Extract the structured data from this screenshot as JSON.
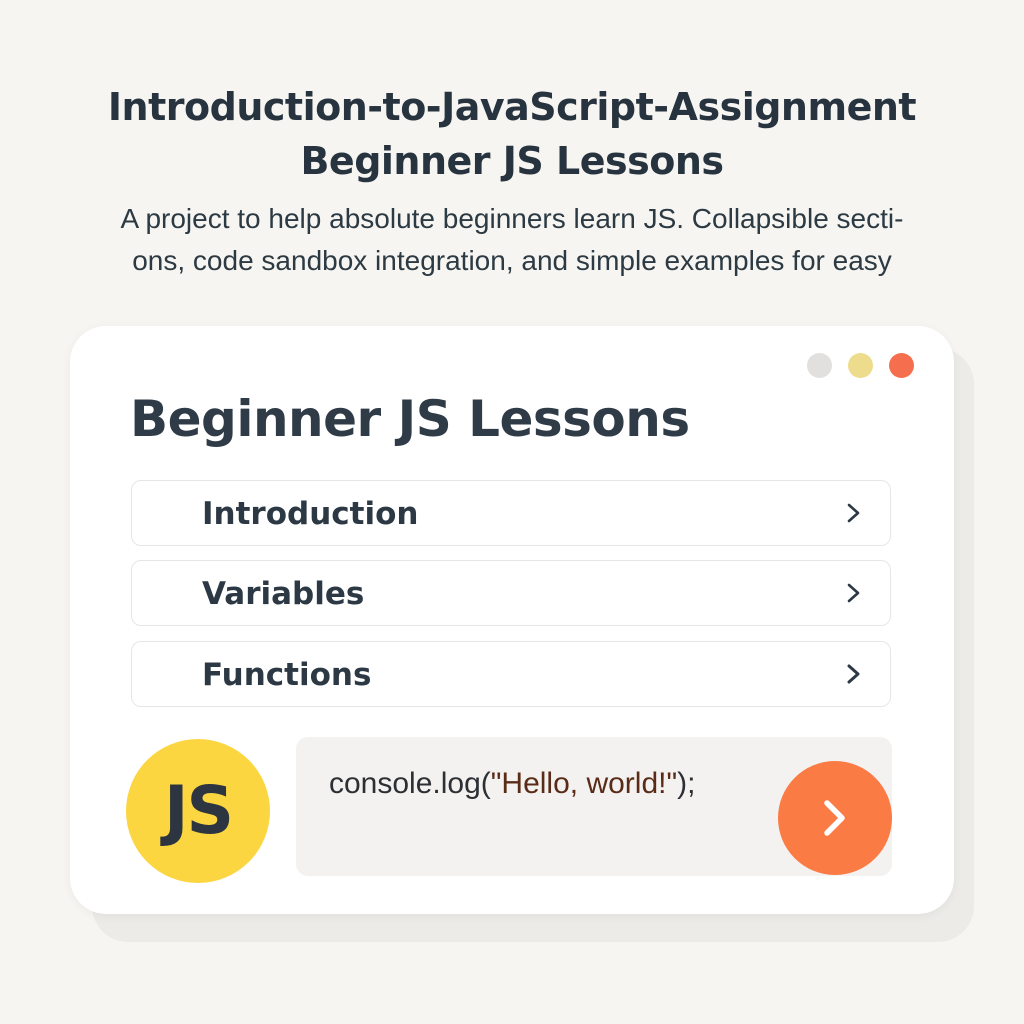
{
  "header": {
    "title_line1": "Introduction-to-JavaScript-Assignment",
    "title_line2": "Beginner JS Lessons",
    "description_line1": "A project to help absolute beginners learn JS. Collapsible secti-",
    "description_line2": "ons, code sandbox integration, and simple examples for easy"
  },
  "window": {
    "controls": [
      "gray",
      "yellow",
      "red"
    ],
    "title": "Beginner JS Lessons"
  },
  "lessons": [
    {
      "label": "Introduction",
      "icon": "chevron-right-icon"
    },
    {
      "label": "Variables",
      "icon": "chevron-right-icon"
    },
    {
      "label": "Functions",
      "icon": "chevron-right-icon"
    }
  ],
  "js_badge": {
    "text": "JS"
  },
  "code": {
    "prefix": "console.log(",
    "string": "\"Hello, world!\"",
    "suffix": ");"
  },
  "run_button": {
    "icon": "chevron-right-icon"
  },
  "colors": {
    "background": "#f7f5f1",
    "text_dark": "#27343f",
    "js_yellow": "#fbd641",
    "run_orange": "#fb7b45",
    "dot_gray": "#e1e0de",
    "dot_yellow": "#eddc8c",
    "dot_red": "#f56e4d"
  }
}
